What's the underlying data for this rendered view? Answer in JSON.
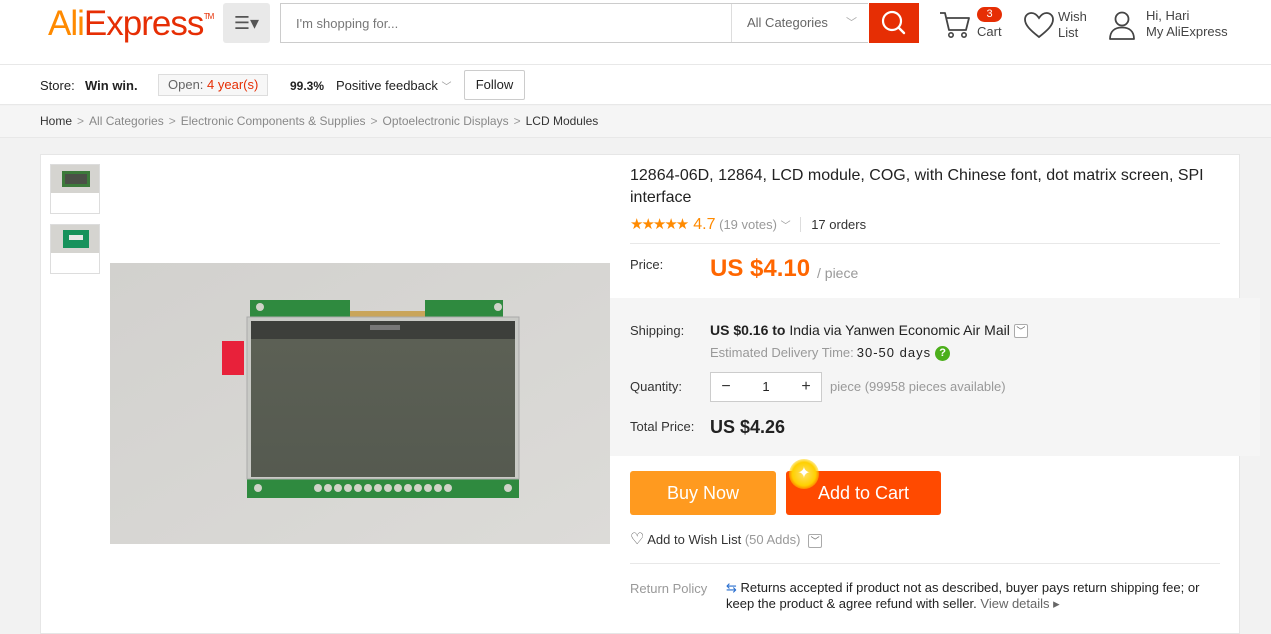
{
  "header": {
    "logo_part1": "Ali",
    "logo_part2": "Express",
    "logo_tm": "TM",
    "search_placeholder": "I'm shopping for...",
    "category": "All Categories",
    "cart_count": "3",
    "cart_label": "Cart",
    "wish_line1": "Wish",
    "wish_line2": "List",
    "user_greeting": "Hi, Hari",
    "user_account": "My AliExpress"
  },
  "store": {
    "label": "Store:",
    "name": "Win win.",
    "open_label": "Open:",
    "open_value": "4 year(s)",
    "feedback_percent": "99.3%",
    "feedback_label": "Positive feedback",
    "follow_label": "Follow"
  },
  "breadcrumb": {
    "items": [
      "Home",
      "All Categories",
      "Electronic Components & Supplies",
      "Optoelectronic Displays",
      "LCD Modules"
    ],
    "separator": ">"
  },
  "product": {
    "title": "12864-06D, 12864, LCD module, COG, with Chinese font, dot matrix screen, SPI interface",
    "rating": "4.7",
    "rating_stars": 4.7,
    "votes": "(19 votes)",
    "orders": "17 orders",
    "price_label": "Price:",
    "price": "US $4.10",
    "price_unit": "/ piece",
    "shipping_label": "Shipping:",
    "shipping_cost": "US $0.16",
    "shipping_to": "to",
    "shipping_dest": "India via Yanwen Economic Air Mail",
    "eta_label": "Estimated Delivery Time:",
    "eta_value": "30-50 days",
    "quantity_label": "Quantity:",
    "quantity_value": "1",
    "quantity_minus": "−",
    "quantity_plus": "+",
    "availability": "piece (99958 pieces available)",
    "total_label": "Total Price:",
    "total_price": "US $4.26",
    "buy_now": "Buy Now",
    "add_to_cart": "Add to Cart",
    "wish_label": "Add to Wish List",
    "wish_adds": "(50 Adds)",
    "return_label": "Return Policy",
    "return_text": "Returns accepted if product not as described, buyer pays return shipping fee; or keep the product & agree refund with seller.",
    "return_link": "View details"
  },
  "colors": {
    "brand_orange": "#ff8a00",
    "brand_red": "#e62e04",
    "price_orange": "#ff6600"
  }
}
